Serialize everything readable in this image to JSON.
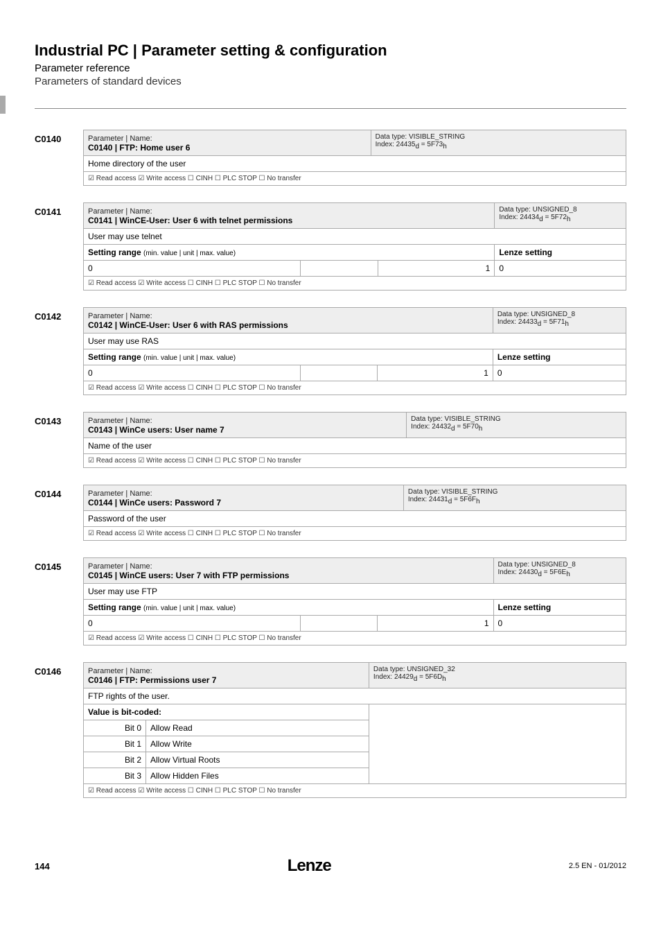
{
  "header": {
    "title": "Industrial PC | Parameter setting & configuration",
    "sub1": "Parameter reference",
    "sub2": "Parameters of standard devices"
  },
  "access_line": "☑ Read access   ☑ Write access   ☐ CINH   ☐ PLC STOP   ☐ No transfer",
  "entries": [
    {
      "id": "C0140",
      "name_label": "Parameter | Name:",
      "name": "C0140 | FTP: Home user 6",
      "dtype": "Data type: VISIBLE_STRING",
      "idx": "Index: 24435",
      "idx_d": "d",
      "idx_eq": " = 5F73",
      "idx_h": "h",
      "desc": "Home directory of the user",
      "has_setting": false,
      "bits": null
    },
    {
      "id": "C0141",
      "name_label": "Parameter | Name:",
      "name": "C0141 | WinCE-User: User 6 with telnet permissions",
      "dtype": "Data type: UNSIGNED_8",
      "idx": "Index: 24434",
      "idx_d": "d",
      "idx_eq": " = 5F72",
      "idx_h": "h",
      "desc": "User may use telnet",
      "has_setting": true,
      "setting": {
        "range_label": "Setting range (min. value | unit | max. value)",
        "lenze_label": "Lenze setting",
        "min": "0",
        "mid": "",
        "max": "1",
        "lenze": "0"
      },
      "bits": null
    },
    {
      "id": "C0142",
      "name_label": "Parameter | Name:",
      "name": "C0142 | WinCE-User: User 6 with RAS permissions",
      "dtype": "Data type: UNSIGNED_8",
      "idx": "Index: 24433",
      "idx_d": "d",
      "idx_eq": " = 5F71",
      "idx_h": "h",
      "desc": "User may use RAS",
      "has_setting": true,
      "setting": {
        "range_label": "Setting range (min. value | unit | max. value)",
        "lenze_label": "Lenze setting",
        "min": "0",
        "mid": "",
        "max": "1",
        "lenze": "0"
      },
      "bits": null
    },
    {
      "id": "C0143",
      "name_label": "Parameter | Name:",
      "name": "C0143 | WinCe users: User name 7",
      "dtype": "Data type: VISIBLE_STRING",
      "idx": "Index: 24432",
      "idx_d": "d",
      "idx_eq": " = 5F70",
      "idx_h": "h",
      "desc": "Name of the user",
      "has_setting": false,
      "bits": null
    },
    {
      "id": "C0144",
      "name_label": "Parameter | Name:",
      "name": "C0144 | WinCe users: Password 7",
      "dtype": "Data type: VISIBLE_STRING",
      "idx": "Index: 24431",
      "idx_d": "d",
      "idx_eq": " = 5F6F",
      "idx_h": "h",
      "desc": "Password of the user",
      "has_setting": false,
      "bits": null
    },
    {
      "id": "C0145",
      "name_label": "Parameter | Name:",
      "name": "C0145 | WinCE users: User 7 with FTP permissions",
      "dtype": "Data type: UNSIGNED_8",
      "idx": "Index: 24430",
      "idx_d": "d",
      "idx_eq": " = 5F6E",
      "idx_h": "h",
      "desc": "User may use FTP",
      "has_setting": true,
      "setting": {
        "range_label": "Setting range (min. value | unit | max. value)",
        "lenze_label": "Lenze setting",
        "min": "0",
        "mid": "",
        "max": "1",
        "lenze": "0"
      },
      "bits": null
    },
    {
      "id": "C0146",
      "name_label": "Parameter | Name:",
      "name": "C0146 | FTP: Permissions user 7",
      "dtype": "Data type: UNSIGNED_32",
      "idx": "Index: 24429",
      "idx_d": "d",
      "idx_eq": " = 5F6D",
      "idx_h": "h",
      "desc": "FTP rights of the user.",
      "has_setting": false,
      "bits": {
        "label": "Value is bit-coded:",
        "rows": [
          {
            "bit": "Bit 0",
            "val": "Allow Read"
          },
          {
            "bit": "Bit 1",
            "val": "Allow Write"
          },
          {
            "bit": "Bit 2",
            "val": "Allow Virtual Roots"
          },
          {
            "bit": "Bit 3",
            "val": "Allow Hidden Files"
          }
        ]
      }
    }
  ],
  "footer": {
    "page": "144",
    "logo": "Lenze",
    "rev": "2.5 EN - 01/2012"
  }
}
